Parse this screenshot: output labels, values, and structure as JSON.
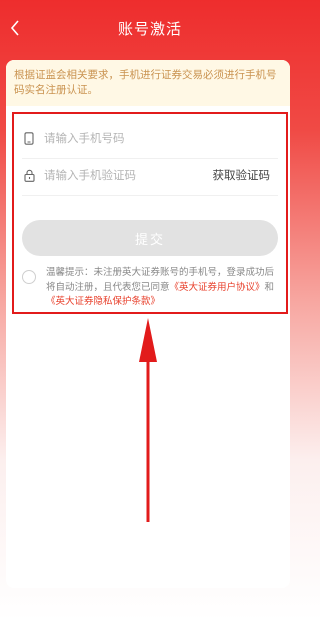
{
  "header": {
    "title": "账号激活",
    "back_icon": "chevron-left-icon"
  },
  "notice": {
    "text": "根据证监会相关要求，手机进行证券交易必须进行手机号码实名注册认证。"
  },
  "form": {
    "phone_placeholder": "请输入手机号码",
    "code_placeholder": "请输入手机验证码",
    "get_code_label": "获取验证码",
    "submit_label": "提交"
  },
  "agreement": {
    "prefix": "温馨提示：未注册英大证券账号的手机号，登录成功后将自动注册，且代表您已同意",
    "link1": "《英大证券用户协议》",
    "conjunction": "和",
    "link2": "《英大证券隐私保护条款》"
  },
  "colors": {
    "brand_red": "#ee2d2d",
    "highlight_red": "#e21b1b",
    "notice_text": "#c9924f",
    "link_red": "#e8402c"
  }
}
